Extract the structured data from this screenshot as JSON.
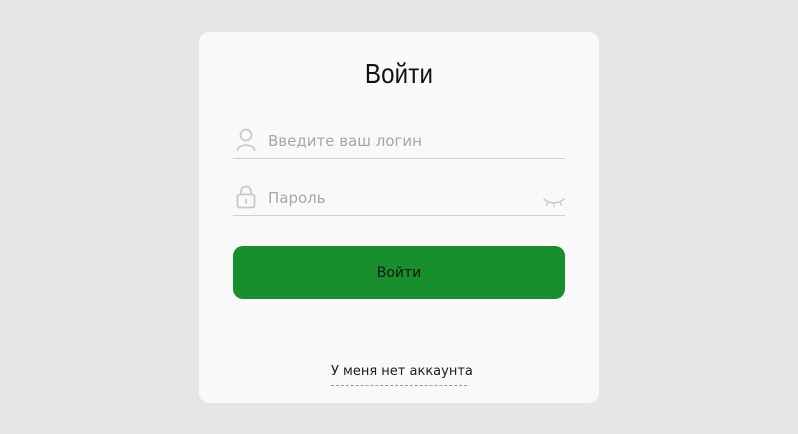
{
  "login_form": {
    "title": "Войти",
    "login_field": {
      "placeholder": "Введите ваш логин",
      "value": "",
      "icon": "user-icon"
    },
    "password_field": {
      "placeholder": "Пароль",
      "value": "",
      "icon": "lock-icon",
      "visibility_icon": "eye-closed-icon"
    },
    "submit_label": "Войти",
    "register_link": "У меня нет аккаунта"
  },
  "colors": {
    "page_background": "#e5e5e5",
    "card_background": "#f9f9f9",
    "primary_button": "#178f2d",
    "field_border": "#cfcfcf",
    "placeholder": "#a7a7a7"
  }
}
